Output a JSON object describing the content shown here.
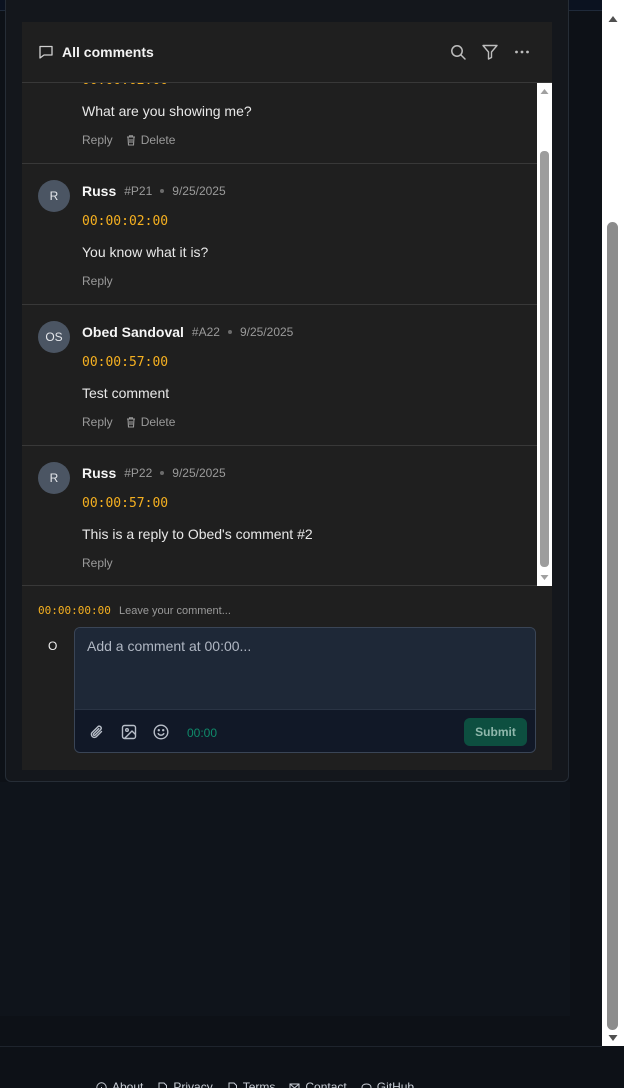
{
  "header": {
    "title": "All comments"
  },
  "comments": [
    {
      "text": "What are you showing me?",
      "actions": [
        "Reply",
        "Delete"
      ]
    },
    {
      "initials": "R",
      "author": "Russ",
      "id": "#P21",
      "date": "9/25/2025",
      "timestamp": "00:00:02:00",
      "text": "You know what it is?",
      "actions": [
        "Reply"
      ]
    },
    {
      "initials": "OS",
      "author": "Obed Sandoval",
      "id": "#A22",
      "date": "9/25/2025",
      "timestamp": "00:00:57:00",
      "text": "Test comment",
      "actions": [
        "Reply",
        "Delete"
      ]
    },
    {
      "initials": "R",
      "author": "Russ",
      "id": "#P22",
      "date": "9/25/2025",
      "timestamp": "00:00:57:00",
      "text": "This is a reply to Obed's comment #2",
      "actions": [
        "Reply"
      ]
    }
  ],
  "composer": {
    "timestamp": "00:00:00:00",
    "hint": "Leave your comment...",
    "user_initial": "O",
    "placeholder": "Add a comment at 00:00...",
    "time": "00:00",
    "submit_label": "Submit"
  },
  "footer": {
    "links": [
      "About",
      "Privacy",
      "Terms",
      "Contact",
      "GitHub"
    ]
  },
  "colors": {
    "timestamp": "#f5b020",
    "submit_bg": "#0d4f40",
    "avatar_bg": "#4b5563"
  },
  "icons": [
    "comment-icon",
    "search-icon",
    "filter-icon",
    "more-icon",
    "trash-icon",
    "paperclip-icon",
    "image-icon",
    "emoji-icon",
    "info-icon",
    "document-icon",
    "mail-icon",
    "github-icon"
  ]
}
